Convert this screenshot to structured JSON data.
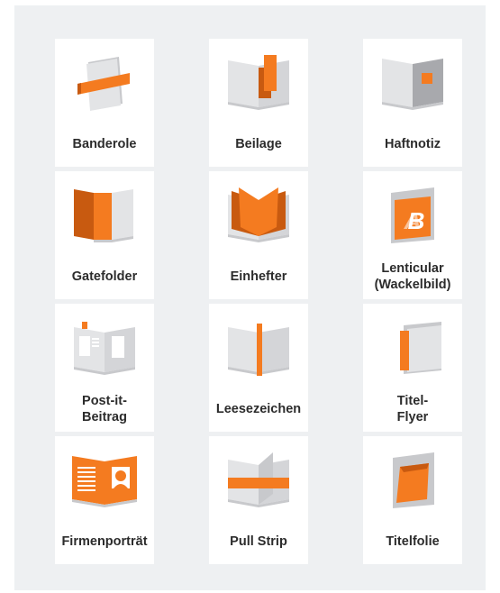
{
  "colors": {
    "accent": "#f47b20",
    "accent_dark": "#c85a10",
    "paper": "#e3e4e6",
    "paper_shade": "#c8c9cc",
    "background": "#eef0f2",
    "card": "#ffffff",
    "text": "#2c2c2c"
  },
  "items": [
    {
      "label": "Banderole",
      "icon": "banderole-icon"
    },
    {
      "label": "Beilage",
      "icon": "beilage-icon"
    },
    {
      "label": "Haftnotiz",
      "icon": "haftnotiz-icon"
    },
    {
      "label": "Gatefolder",
      "icon": "gatefolder-icon"
    },
    {
      "label": "Einhefter",
      "icon": "einhefter-icon"
    },
    {
      "label": "Lenticular\n(Wackelbild)",
      "icon": "lenticular-icon"
    },
    {
      "label": "Post-it-\nBeitrag",
      "icon": "post-it-icon"
    },
    {
      "label": "Leesezeichen",
      "icon": "leesezeichen-icon"
    },
    {
      "label": "Titel-\nFlyer",
      "icon": "titel-flyer-icon"
    },
    {
      "label": "Firmenporträt",
      "icon": "firmenportraet-icon"
    },
    {
      "label": "Pull Strip",
      "icon": "pull-strip-icon"
    },
    {
      "label": "Titelfolie",
      "icon": "titelfolie-icon"
    }
  ]
}
